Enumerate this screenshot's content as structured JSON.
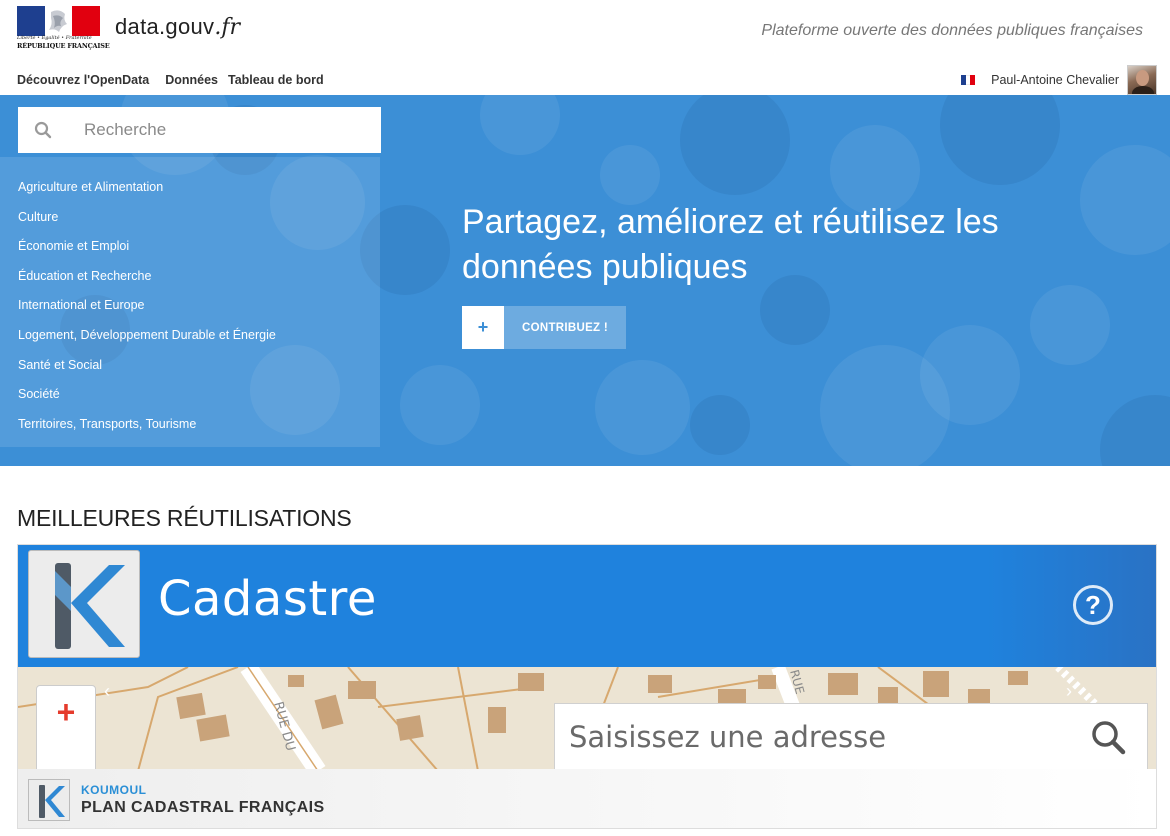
{
  "header": {
    "gov_motto": "Liberté • Égalité • Fraternité",
    "gov_name": "RÉPUBLIQUE FRANÇAISE",
    "brand_domain": "data.gouv",
    "brand_tld": ".fr",
    "tagline": "Plateforme ouverte des données publiques françaises"
  },
  "nav": {
    "items": [
      {
        "label": "Découvrez l'OpenData"
      },
      {
        "label": "Données"
      },
      {
        "label": "Tableau de bord"
      }
    ]
  },
  "user": {
    "language_icon": "fr-flag-icon",
    "name": "Paul-Antoine Chevalier"
  },
  "search": {
    "placeholder": "Recherche"
  },
  "topics": [
    {
      "label": "Agriculture et Alimentation"
    },
    {
      "label": "Culture"
    },
    {
      "label": "Économie et Emploi"
    },
    {
      "label": "Éducation et Recherche"
    },
    {
      "label": "International et Europe"
    },
    {
      "label": "Logement, Développement Durable et Énergie"
    },
    {
      "label": "Santé et Social"
    },
    {
      "label": "Société"
    },
    {
      "label": "Territoires, Transports, Tourisme"
    }
  ],
  "hero": {
    "title": "Partagez, améliorez et réutilisez les données publiques",
    "cta_icon": "+",
    "cta_label": "CONTRIBUEZ !"
  },
  "reuses": {
    "section_title": "MEILLEURES RÉUTILISATIONS",
    "featured": {
      "app_title": "Cadastre",
      "help_icon": "?",
      "map_zoom_in": "+",
      "address_placeholder": "Saisissez une adresse",
      "prev_arrow": "‹",
      "next_arrow": "›",
      "street_label_1": "RUE DU",
      "street_label_2": "RUE",
      "organization": "KOUMOUL",
      "title": "PLAN CADASTRAL FRANÇAIS"
    }
  },
  "colors": {
    "hero_blue": "#3c8fd6",
    "banner_blue": "#1f82dd",
    "accent_red": "#e53b2c",
    "org_blue": "#2a8fd6",
    "flag_blue": "#1e3f8f",
    "flag_red": "#e1000f"
  }
}
